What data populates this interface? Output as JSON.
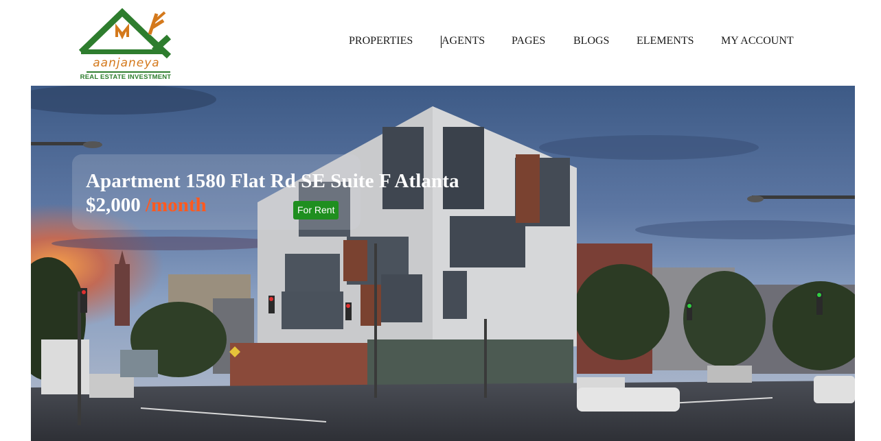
{
  "brand": {
    "name": "aanjaneya",
    "tagline": "REAL ESTATE INVESTMENT",
    "primary_color": "#2e7d2e",
    "accent_color": "#d4791c"
  },
  "nav": {
    "items": [
      {
        "label": "PROPERTIES"
      },
      {
        "label": "AGENTS"
      },
      {
        "label": "PAGES"
      },
      {
        "label": "BLOGS"
      },
      {
        "label": "ELEMENTS"
      },
      {
        "label": "MY ACCOUNT"
      }
    ]
  },
  "listing": {
    "title": "Apartment 1580 Flat Rd SE Suite F Atlanta",
    "price": "$2,000",
    "period": "/month",
    "status_badge": "For Rent",
    "price_period_color": "#ff5a1f",
    "badge_color": "#1f8f1f"
  }
}
